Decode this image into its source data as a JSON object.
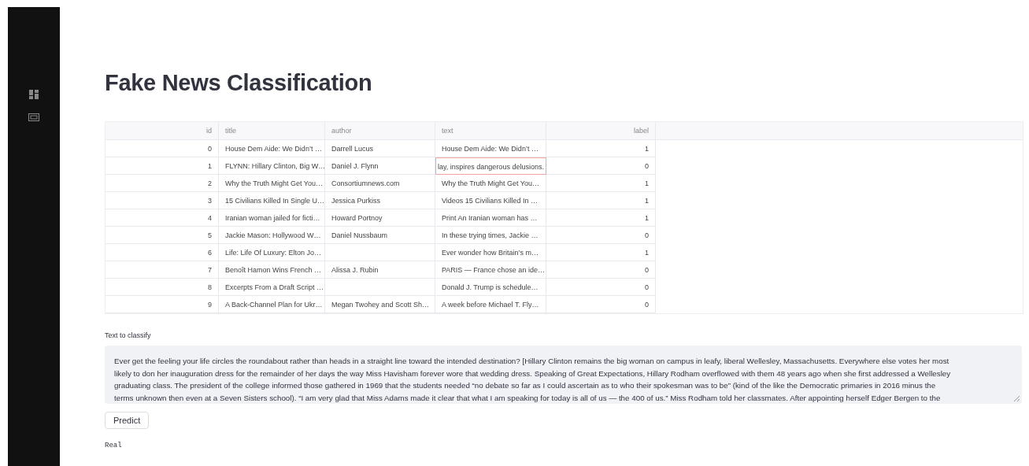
{
  "title": "Fake News Classification",
  "table": {
    "columns": [
      "id",
      "title",
      "author",
      "text",
      "label"
    ],
    "rows": [
      {
        "cells": [
          "0",
          "House Dem Aide: We Didn’t …",
          "Darrell Lucus",
          "House Dem Aide: We Didn’t …",
          "1"
        ],
        "text_selected": false
      },
      {
        "cells": [
          "1",
          "FLYNN: Hillary Clinton, Big W…",
          "Daniel J. Flynn",
          "lay, inspires dangerous delusions.",
          "0"
        ],
        "text_selected": true
      },
      {
        "cells": [
          "2",
          "Why the Truth Might Get You…",
          "Consortiumnews.com",
          "Why the Truth Might Get You…",
          "1"
        ],
        "text_selected": false
      },
      {
        "cells": [
          "3",
          "15 Civilians Killed In Single U…",
          "Jessica Purkiss",
          "Videos 15 Civilians Killed In …",
          "1"
        ],
        "text_selected": false
      },
      {
        "cells": [
          "4",
          "Iranian woman jailed for ficti…",
          "Howard Portnoy",
          "Print An Iranian woman has …",
          "1"
        ],
        "text_selected": false
      },
      {
        "cells": [
          "5",
          "Jackie Mason: Hollywood W…",
          "Daniel Nussbaum",
          "In these trying times, Jackie …",
          "0"
        ],
        "text_selected": false
      },
      {
        "cells": [
          "6",
          "Life: Life Of Luxury: Elton Jo…",
          "",
          "Ever wonder how Britain’s m…",
          "1"
        ],
        "text_selected": false
      },
      {
        "cells": [
          "7",
          "Benoît Hamon Wins French …",
          "Alissa J. Rubin",
          "PARIS — France chose an ide…",
          "0"
        ],
        "text_selected": false
      },
      {
        "cells": [
          "8",
          "Excerpts From a Draft Script …",
          "",
          "Donald J. Trump is schedule…",
          "0"
        ],
        "text_selected": false
      },
      {
        "cells": [
          "9",
          "A Back-Channel Plan for Ukr…",
          "Megan Twohey and Scott Sh…",
          "A week before Michael T. Fly…",
          "0"
        ],
        "text_selected": false
      }
    ]
  },
  "input": {
    "label": "Text to classify",
    "value_lines": [
      "Ever get the feeling your life circles the roundabout rather than heads in a straight line toward the intended destination? [Hillary Clinton remains the big woman on campus in leafy, liberal Wellesley, Massachusetts. Everywhere else votes her most",
      "likely to don her inauguration dress for the remainder of her days the way Miss Havisham forever wore that wedding dress.  Speaking of Great Expectations, Hillary Rodham overflowed with them 48 years ago when she first addressed a Wellesley",
      "graduating class. The president of the college informed those gathered in 1969 that the students needed “no debate so far as I could ascertain as to who their spokesman was to be” (kind of the like the Democratic primaries in 2016 minus the",
      "terms unknown then even at a Seven Sisters school). “I am very glad that Miss Adams made it clear that what I am speaking for today is all of us — the 400 of us.” Miss Rodham told her classmates. After appointing herself Edger Bergen to the"
    ]
  },
  "button": "Predict",
  "result": "Real"
}
